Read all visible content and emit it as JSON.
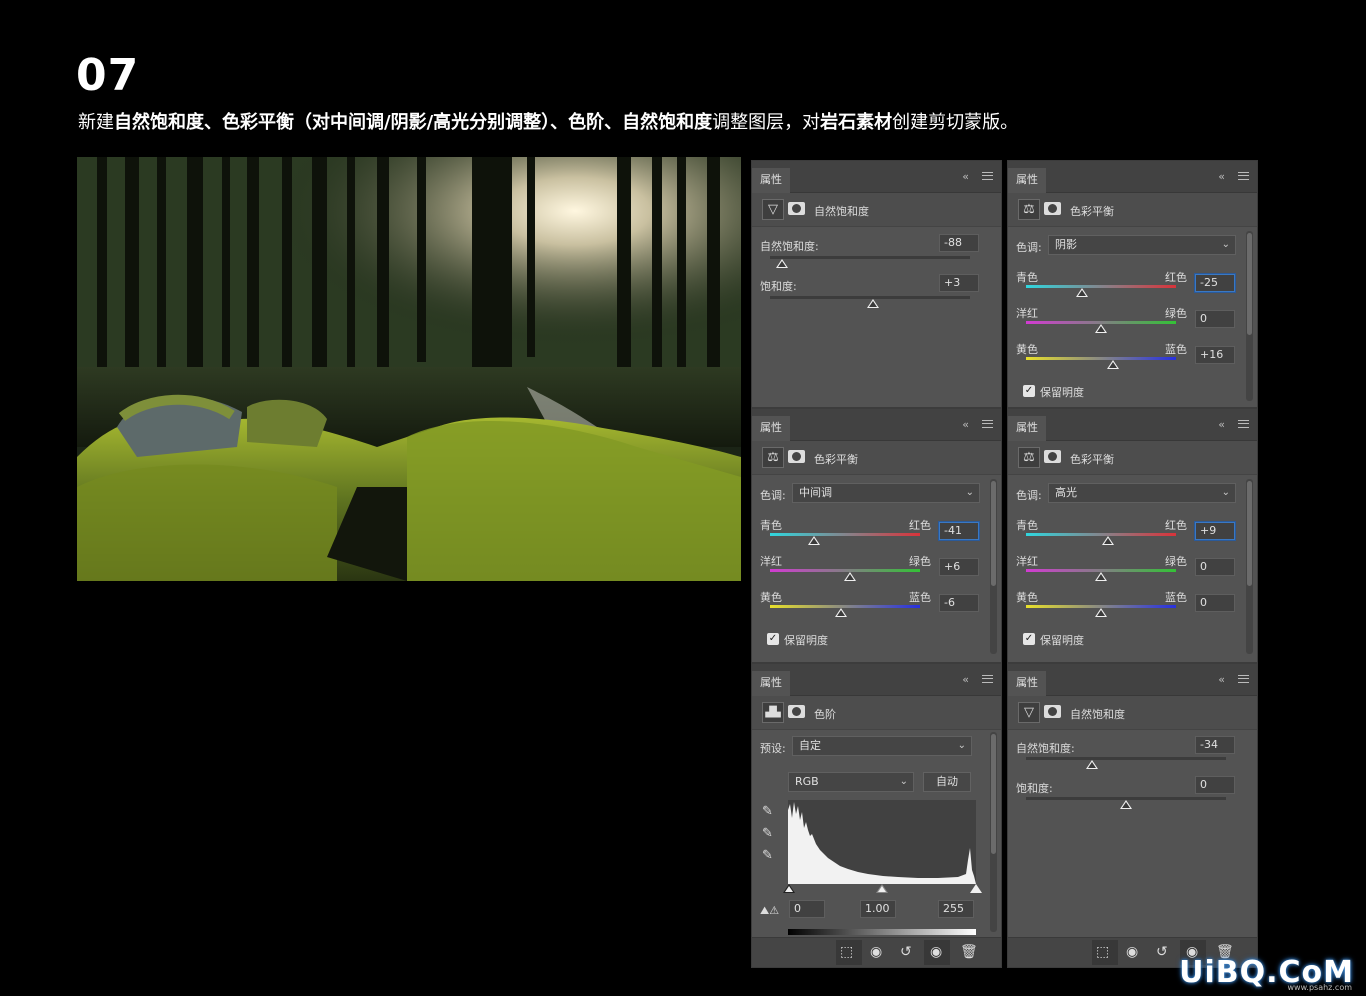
{
  "step": "07",
  "description": {
    "p1": "新建",
    "b1": "自然饱和度、色彩平衡（对中间调/阴影/高光分别调整）、色阶、自然饱和度",
    "p2": "调整图层，对",
    "b2": "岩石素材",
    "p3": "创建剪切蒙版。"
  },
  "panel_tab": "属性",
  "panel_ctrl": "‹‹",
  "panels": {
    "vib1": {
      "title": "自然饱和度",
      "vibrance_label": "自然饱和度:",
      "vibrance": "-88",
      "vibrance_value": -88,
      "saturation_label": "饱和度:",
      "saturation": "+3",
      "saturation_value": 3
    },
    "cb_shadow": {
      "title": "色彩平衡",
      "tone_label": "色调:",
      "tone": "阴影",
      "cyan": "青色",
      "red": "红色",
      "magenta": "洋红",
      "green": "绿色",
      "yellow": "黄色",
      "blue": "蓝色",
      "cr": "-25",
      "mg": "0",
      "yb": "+16",
      "cr_value": -25,
      "mg_value": 0,
      "yb_value": 16,
      "preserve": "保留明度"
    },
    "cb_mid": {
      "title": "色彩平衡",
      "tone_label": "色调:",
      "tone": "中间调",
      "cyan": "青色",
      "red": "红色",
      "magenta": "洋红",
      "green": "绿色",
      "yellow": "黄色",
      "blue": "蓝色",
      "cr": "-41",
      "mg": "+6",
      "yb": "-6",
      "cr_value": -41,
      "mg_value": 6,
      "yb_value": -6,
      "preserve": "保留明度"
    },
    "cb_high": {
      "title": "色彩平衡",
      "tone_label": "色调:",
      "tone": "高光",
      "cyan": "青色",
      "red": "红色",
      "magenta": "洋红",
      "green": "绿色",
      "yellow": "黄色",
      "blue": "蓝色",
      "cr": "+9",
      "mg": "0",
      "yb": "0",
      "cr_value": 9,
      "mg_value": 0,
      "yb_value": 0,
      "preserve": "保留明度"
    },
    "levels": {
      "title": "色阶",
      "preset_label": "预设:",
      "preset": "自定",
      "channel": "RGB",
      "auto": "自动",
      "black": "0",
      "gamma": "1.00",
      "white": "255"
    },
    "vib2": {
      "title": "自然饱和度",
      "vibrance_label": "自然饱和度:",
      "vibrance": "-34",
      "vibrance_value": -34,
      "saturation_label": "饱和度:",
      "saturation": "0",
      "saturation_value": 0
    }
  },
  "watermark": {
    "main": "UiBQ.CoM",
    "sub": "www.psahz.com"
  }
}
